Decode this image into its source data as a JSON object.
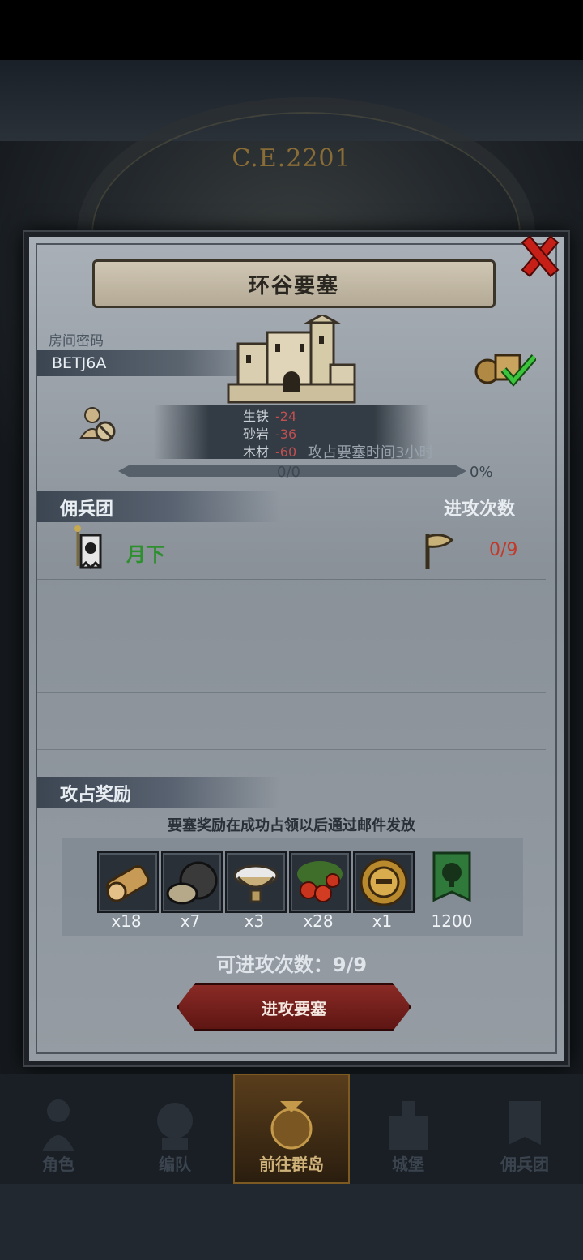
{
  "header": {
    "year": "C.E.2201"
  },
  "modal": {
    "title": "环谷要塞",
    "room_label": "房间密码",
    "room_code": "BETJ6A",
    "resources": [
      {
        "name": "生铁",
        "value": "-24"
      },
      {
        "name": "砂岩",
        "value": "-36"
      },
      {
        "name": "木材",
        "value": "-60"
      }
    ],
    "occupy_text": "攻占要塞时间3小时",
    "progress": {
      "count": "0/0",
      "percent": "0%",
      "fraction": 0
    },
    "mercenary": {
      "section_label": "佣兵团",
      "attempts_label": "进攻次数",
      "name": "月下",
      "attempts": "0/9"
    },
    "rewards": {
      "section_label": "攻占奖励",
      "note": "要塞奖励在成功占领以后通过邮件发放",
      "items": [
        {
          "icon": "wood-log-icon",
          "count": "x18"
        },
        {
          "icon": "iron-ore-icon",
          "count": "x7"
        },
        {
          "icon": "silver-bowl-icon",
          "count": "x3"
        },
        {
          "icon": "berries-icon",
          "count": "x28"
        },
        {
          "icon": "golden-helmet-icon",
          "count": "x1"
        },
        {
          "icon": "tree-banner-icon",
          "count": "1200"
        }
      ]
    },
    "remaining_attacks": "可进攻次数：9/9",
    "attack_button": "进攻要塞"
  },
  "bottom_nav": [
    {
      "label": "角色",
      "icon": "knight-icon"
    },
    {
      "label": "编队",
      "icon": "formation-icon"
    },
    {
      "label": "前往群岛",
      "icon": "islands-icon",
      "active": true
    },
    {
      "label": "城堡",
      "icon": "castle-icon"
    },
    {
      "label": "佣兵团",
      "icon": "mercenary-icon"
    }
  ],
  "colors": {
    "accent_red": "#c0392b",
    "mercenary_green": "#2e8f2e",
    "button_red": "#8a2a26"
  }
}
